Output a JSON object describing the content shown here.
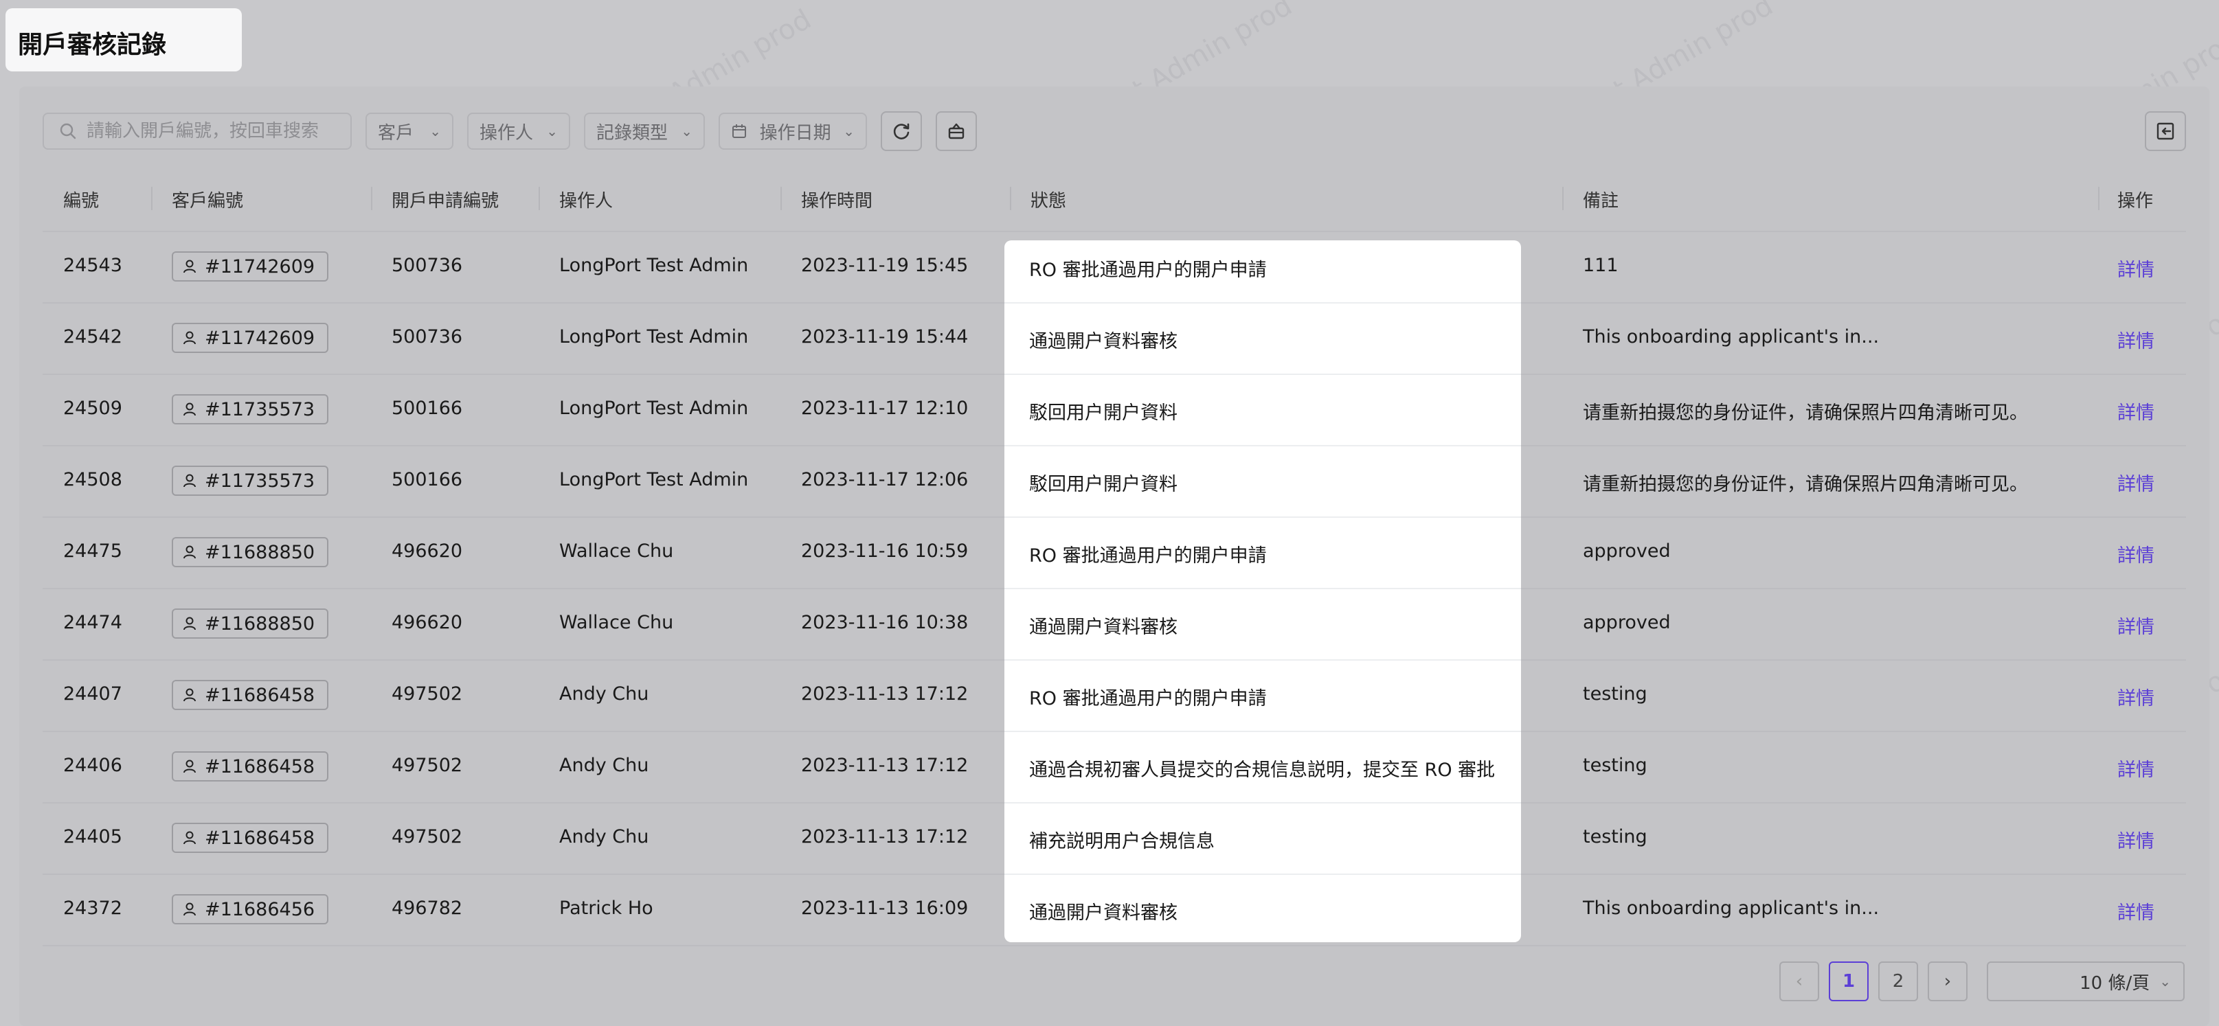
{
  "page_title": "開戶審核記錄",
  "watermark": "LongPort Test Admin prod",
  "toolbar": {
    "search_placeholder": "請輸入開戶編號，按回車搜索",
    "filters": [
      "客戶",
      "操作人",
      "記錄類型",
      "操作日期"
    ],
    "search_icon": "search-icon",
    "refresh_icon": "refresh-icon",
    "basket_icon": "basket-icon",
    "export_icon": "export-icon"
  },
  "table": {
    "columns": [
      "編號",
      "客戶編號",
      "開戶申請編號",
      "操作人",
      "操作時間",
      "狀態",
      "備註",
      "操作"
    ],
    "rows": [
      {
        "id": "24543",
        "customer": "#11742609",
        "app": "500736",
        "operator": "LongPort Test Admin",
        "time": "2023-11-19 15:45",
        "status": "RO 審批通過用户的開户申請",
        "remark": "111",
        "action": "詳情"
      },
      {
        "id": "24542",
        "customer": "#11742609",
        "app": "500736",
        "operator": "LongPort Test Admin",
        "time": "2023-11-19 15:44",
        "status": "通過開户資料審核",
        "remark": "This onboarding applicant's in...",
        "action": "詳情"
      },
      {
        "id": "24509",
        "customer": "#11735573",
        "app": "500166",
        "operator": "LongPort Test Admin",
        "time": "2023-11-17 12:10",
        "status": "駁回用户開户資料",
        "remark": "请重新拍摄您的身份证件，请确保照片四角清晰可见。",
        "action": "詳情"
      },
      {
        "id": "24508",
        "customer": "#11735573",
        "app": "500166",
        "operator": "LongPort Test Admin",
        "time": "2023-11-17 12:06",
        "status": "駁回用户開户資料",
        "remark": "请重新拍摄您的身份证件，请确保照片四角清晰可见。",
        "action": "詳情"
      },
      {
        "id": "24475",
        "customer": "#11688850",
        "app": "496620",
        "operator": "Wallace Chu",
        "time": "2023-11-16 10:59",
        "status": "RO 審批通過用户的開户申請",
        "remark": "approved",
        "action": "詳情"
      },
      {
        "id": "24474",
        "customer": "#11688850",
        "app": "496620",
        "operator": "Wallace Chu",
        "time": "2023-11-16 10:38",
        "status": "通過開户資料審核",
        "remark": "approved",
        "action": "詳情"
      },
      {
        "id": "24407",
        "customer": "#11686458",
        "app": "497502",
        "operator": "Andy Chu",
        "time": "2023-11-13 17:12",
        "status": "RO 審批通過用户的開户申請",
        "remark": "testing",
        "action": "詳情"
      },
      {
        "id": "24406",
        "customer": "#11686458",
        "app": "497502",
        "operator": "Andy Chu",
        "time": "2023-11-13 17:12",
        "status": "通過合規初審人員提交的合規信息説明，提交至 RO 審批",
        "remark": "testing",
        "action": "詳情"
      },
      {
        "id": "24405",
        "customer": "#11686458",
        "app": "497502",
        "operator": "Andy Chu",
        "time": "2023-11-13 17:12",
        "status": "補充説明用户合規信息",
        "remark": "testing",
        "action": "詳情"
      },
      {
        "id": "24372",
        "customer": "#11686456",
        "app": "496782",
        "operator": "Patrick Ho",
        "time": "2023-11-13 16:09",
        "status": "通過開户資料審核",
        "remark": "This onboarding applicant's in...",
        "action": "詳情"
      }
    ]
  },
  "pagination": {
    "pages": [
      "1",
      "2"
    ],
    "current": "1",
    "page_size": "10 條/頁"
  }
}
